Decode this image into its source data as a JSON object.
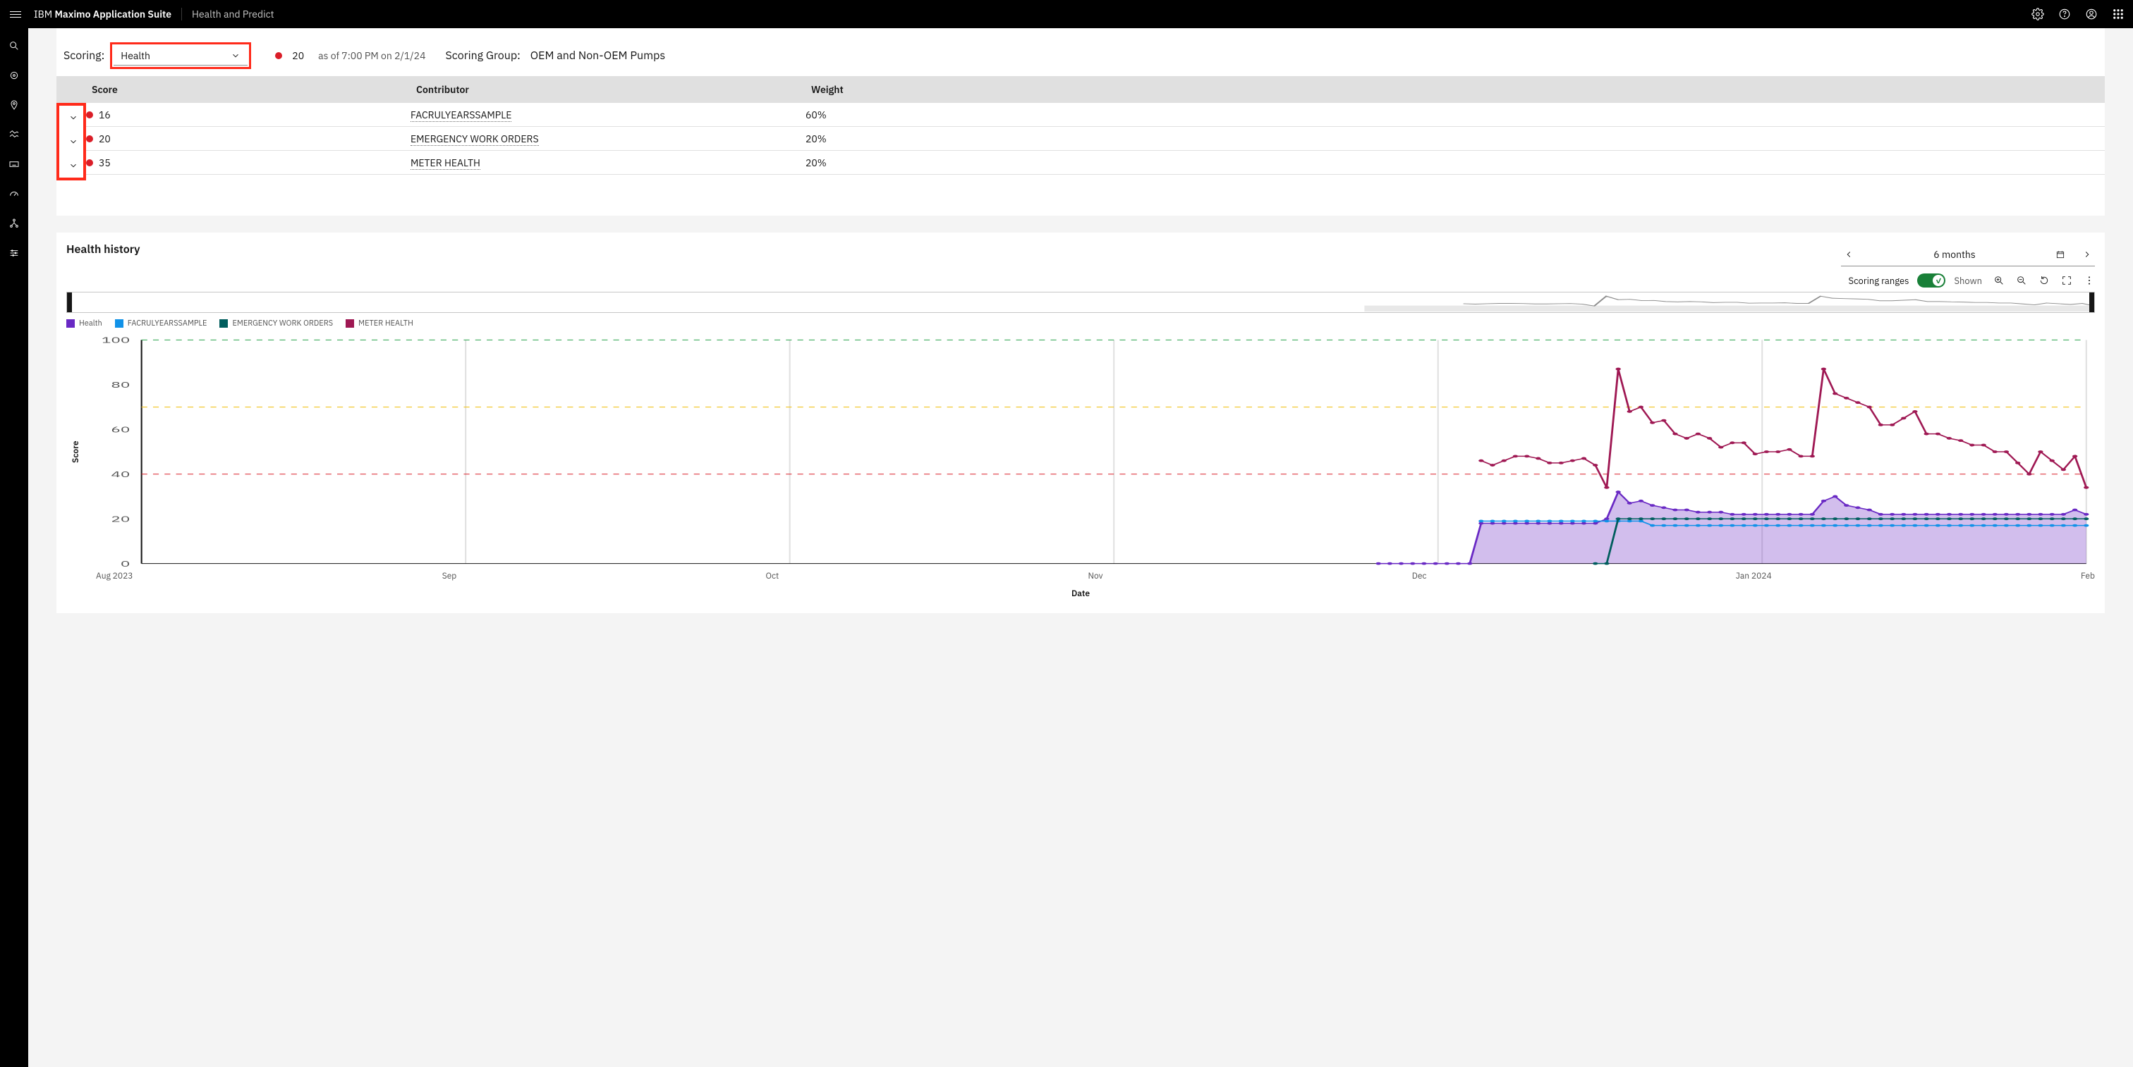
{
  "header": {
    "brand_ibm": "IBM",
    "brand_suite": "Maximo Application Suite",
    "app_name": "Health and Predict"
  },
  "scoring": {
    "label": "Scoring:",
    "selected": "Health",
    "metric_value": "20",
    "asof": "as of 7:00 PM on 2/1/24",
    "group_label": "Scoring Group:",
    "group_value": "OEM and Non-OEM Pumps"
  },
  "table": {
    "headers": {
      "score": "Score",
      "contributor": "Contributor",
      "weight": "Weight"
    },
    "rows": [
      {
        "score": "16",
        "contributor": "FACRULYEARSSAMPLE",
        "weight": "60%"
      },
      {
        "score": "20",
        "contributor": "EMERGENCY WORK ORDERS",
        "weight": "20%"
      },
      {
        "score": "35",
        "contributor": "METER HEALTH",
        "weight": "20%"
      }
    ]
  },
  "history": {
    "title": "Health history",
    "range": "6 months",
    "toggle_label": "Scoring ranges",
    "toggle_state": "Shown",
    "y_title": "Score",
    "x_title": "Date",
    "legend": [
      {
        "name": "Health",
        "color": "#6929c4"
      },
      {
        "name": "FACRULYEARSSAMPLE",
        "color": "#1192e8"
      },
      {
        "name": "EMERGENCY WORK ORDERS",
        "color": "#005d5d"
      },
      {
        "name": "METER HEALTH",
        "color": "#9f1853"
      }
    ],
    "x_ticks": [
      "Aug 2023",
      "Sep",
      "Oct",
      "Nov",
      "Dec",
      "Jan 2024",
      "Feb"
    ],
    "y_ticks": [
      0,
      20,
      40,
      60,
      80,
      100
    ]
  },
  "chart_data": {
    "type": "line",
    "xlabel": "Date",
    "ylabel": "Score",
    "ylim": [
      0,
      100
    ],
    "x_range": [
      "2023-08-01",
      "2024-02-01"
    ],
    "threshold_lines": [
      {
        "value": 100,
        "color": "#24a148",
        "style": "dashed"
      },
      {
        "value": 70,
        "color": "#f1c21b",
        "style": "dashed"
      },
      {
        "value": 40,
        "color": "#da1e28",
        "style": "dashed"
      }
    ],
    "x": [
      0,
      1,
      2,
      3,
      4,
      5,
      6,
      7,
      8,
      9,
      10,
      11,
      12,
      13,
      14,
      15,
      16,
      17,
      18,
      19,
      20,
      21,
      22,
      23,
      24,
      25,
      26,
      27,
      28,
      29,
      30,
      31,
      32,
      33,
      34,
      35,
      36,
      37,
      38,
      39,
      40,
      41,
      42,
      43,
      44,
      45,
      46,
      47,
      48,
      49,
      50,
      51,
      52,
      53,
      54,
      55,
      56,
      57,
      58,
      59,
      60,
      61,
      62
    ],
    "series": [
      {
        "name": "Health",
        "color": "#6929c4",
        "fill": true,
        "values": [
          0,
          0,
          0,
          0,
          0,
          0,
          0,
          0,
          0,
          18,
          18,
          18,
          18,
          18,
          18,
          18,
          18,
          18,
          18,
          18,
          20,
          32,
          27,
          28,
          26,
          25,
          24,
          24,
          23,
          23,
          23,
          22,
          22,
          22,
          22,
          22,
          22,
          22,
          22,
          28,
          30,
          26,
          25,
          24,
          22,
          22,
          22,
          22,
          22,
          22,
          22,
          22,
          22,
          22,
          22,
          22,
          22,
          22,
          22,
          22,
          22,
          24,
          22
        ]
      },
      {
        "name": "FACRULYEARSSAMPLE",
        "color": "#1192e8",
        "fill": false,
        "values": [
          null,
          null,
          null,
          null,
          null,
          null,
          null,
          null,
          null,
          19,
          19,
          19,
          19,
          19,
          19,
          19,
          19,
          19,
          19,
          19,
          19,
          19,
          19,
          19,
          17,
          17,
          17,
          17,
          17,
          17,
          17,
          17,
          17,
          17,
          17,
          17,
          17,
          17,
          17,
          17,
          17,
          17,
          17,
          17,
          17,
          17,
          17,
          17,
          17,
          17,
          17,
          17,
          17,
          17,
          17,
          17,
          17,
          17,
          17,
          17,
          17,
          17,
          17
        ]
      },
      {
        "name": "EMERGENCY WORK ORDERS",
        "color": "#005d5d",
        "fill": false,
        "values": [
          null,
          null,
          null,
          null,
          null,
          null,
          null,
          null,
          null,
          null,
          null,
          null,
          null,
          null,
          null,
          null,
          null,
          null,
          null,
          0,
          0,
          20,
          20,
          20,
          20,
          20,
          20,
          20,
          20,
          20,
          20,
          20,
          20,
          20,
          20,
          20,
          20,
          20,
          20,
          20,
          20,
          20,
          20,
          20,
          20,
          20,
          20,
          20,
          20,
          20,
          20,
          20,
          20,
          20,
          20,
          20,
          20,
          20,
          20,
          20,
          20,
          20,
          20
        ]
      },
      {
        "name": "METER HEALTH",
        "color": "#9f1853",
        "fill": false,
        "values": [
          null,
          null,
          null,
          null,
          null,
          null,
          null,
          null,
          null,
          46,
          44,
          46,
          48,
          48,
          47,
          45,
          45,
          46,
          47,
          44,
          34,
          87,
          68,
          70,
          63,
          64,
          58,
          56,
          58,
          56,
          52,
          54,
          54,
          49,
          50,
          50,
          51,
          48,
          48,
          87,
          76,
          74,
          72,
          70,
          62,
          62,
          65,
          68,
          58,
          58,
          56,
          55,
          53,
          53,
          50,
          50,
          45,
          40,
          50,
          46,
          42,
          48,
          34
        ]
      }
    ]
  }
}
